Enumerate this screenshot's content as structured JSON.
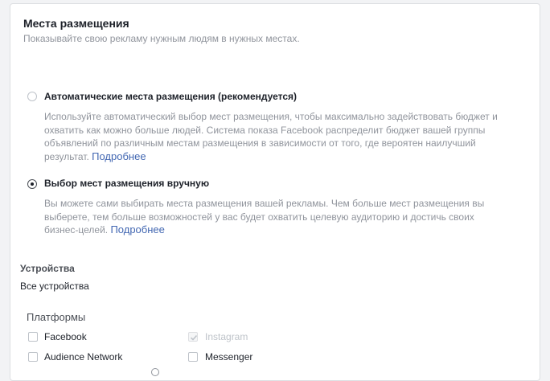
{
  "section": {
    "title": "Места размещения",
    "subtitle": "Показывайте свою рекламу нужным людям в нужных местах."
  },
  "options": [
    {
      "label": "Автоматические места размещения (рекомендуется)",
      "description": "Используйте автоматический выбор мест размещения, чтобы максимально задействовать бюджет и охватить как можно больше людей. Система показа Facebook распределит бюджет вашей группы объявлений по различным местам размещения в зависимости от того, где вероятен наилучший результат.",
      "link": "Подробнее",
      "selected": false
    },
    {
      "label": "Выбор мест размещения вручную",
      "description": "Вы можете сами выбирать места размещения вашей рекламы. Чем больше мест размещения вы выберете, тем больше возможностей у вас будет охватить целевую аудиторию и достичь своих бизнес-целей.",
      "link": "Подробнее",
      "selected": true
    }
  ],
  "devices": {
    "title": "Устройства",
    "value": "Все устройства"
  },
  "platforms": {
    "title": "Платформы",
    "items": [
      {
        "label": "Facebook",
        "checked": false,
        "disabled": false
      },
      {
        "label": "Instagram",
        "checked": true,
        "disabled": true
      },
      {
        "label": "Audience Network",
        "checked": false,
        "disabled": false
      },
      {
        "label": "Messenger",
        "checked": false,
        "disabled": false
      }
    ]
  },
  "colors": {
    "link": "#4267b2",
    "muted_text": "#90949c",
    "primary_text": "#1d2129"
  }
}
